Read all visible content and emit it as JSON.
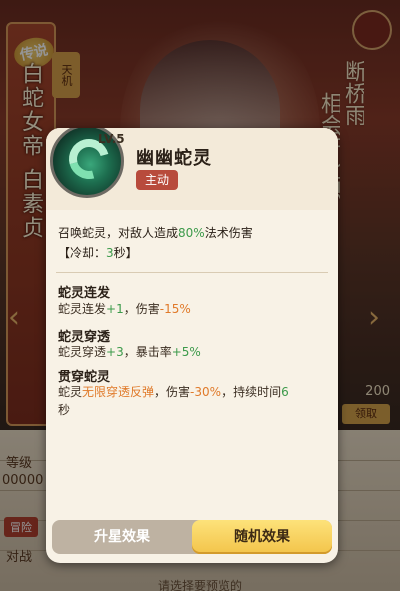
{
  "background": {
    "legend_badge": "传说",
    "hero_title": "白蛇女帝",
    "hero_name": "白素贞",
    "element_badge": "天机",
    "calligraphy_col1": "断桥雨",
    "calligraphy_col2": "相会于此恩",
    "side_label_1": "等级",
    "side_value_1": "00000",
    "side_label_2": "冒险",
    "side_label_3": "对战",
    "claim_label": "领取",
    "claim_value": "200",
    "bottom_hint": "请选择要预览的"
  },
  "popup": {
    "level": "LV.5",
    "skill_name": "幽幽蛇灵",
    "skill_type": "主动",
    "description": {
      "prefix": "召唤蛇灵，对敌人造成",
      "percent": "80%",
      "suffix": "法术伤害"
    },
    "cooldown": {
      "prefix": "【冷却：",
      "value": "3",
      "suffix": "秒】"
    },
    "effects": [
      {
        "title": "蛇灵连发",
        "p1": "蛇灵连发",
        "v1": "+1",
        "p2": "，伤害",
        "v2": "-15%"
      },
      {
        "title": "蛇灵穿透",
        "p1": "蛇灵穿透",
        "v1": "+3",
        "p2": "，暴击率",
        "v2": "+5%"
      },
      {
        "title": "贯穿蛇灵",
        "p1": "蛇灵",
        "v1": "无限穿透反弹",
        "p2": "，伤害",
        "v2": "-30%",
        "p3": "，持续时间",
        "v3": "6",
        "p4": "秒"
      }
    ],
    "tabs": {
      "star_label": "升星效果",
      "random_label": "随机效果",
      "active": "随机效果"
    }
  },
  "colors": {
    "popup_bg": "#f8f2e6",
    "badge_red": "#b84b3c",
    "value_green": "#3c9a4a",
    "value_orange": "#e07a2a",
    "tab_active": "#f3c44a"
  }
}
